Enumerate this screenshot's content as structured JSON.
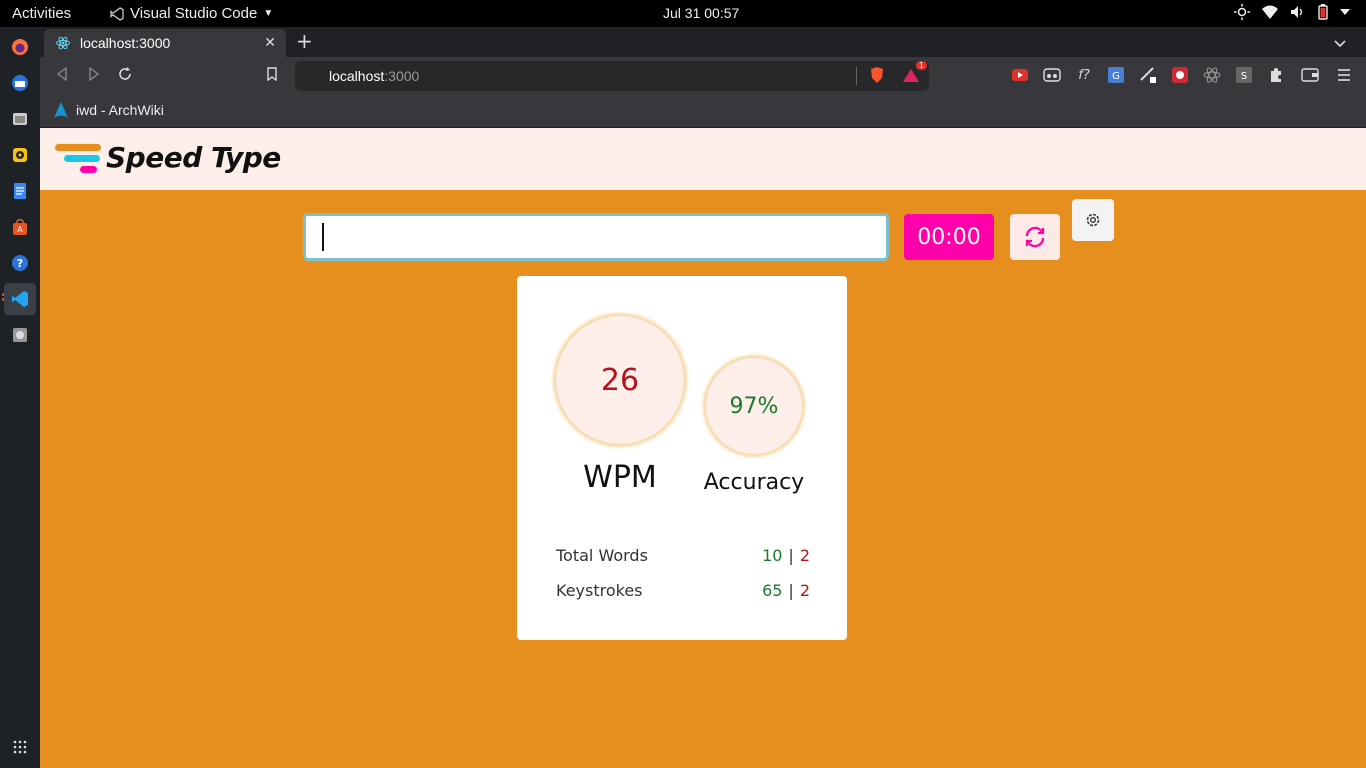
{
  "topbar": {
    "activities": "Activities",
    "app_name": "Visual Studio Code",
    "clock": "Jul 31  00:57"
  },
  "dock": {
    "items": [
      "firefox",
      "thunderbird",
      "files",
      "rhythmbox",
      "writer",
      "software",
      "help",
      "vscode",
      "disks"
    ]
  },
  "browser": {
    "tab_title": "localhost:3000",
    "url_host": "localhost",
    "url_port": ":3000",
    "bookmark": "iwd - ArchWiki",
    "extension_badge": "1"
  },
  "app": {
    "brand": "Speed Type",
    "input_value": "",
    "timer": "00:00",
    "wpm": "26",
    "wpm_label": "WPM",
    "accuracy": "97%",
    "accuracy_label": "Accuracy",
    "stats": [
      {
        "label": "Total Words",
        "correct": "10",
        "separator": "|",
        "incorrect": "2"
      },
      {
        "label": "Keystrokes",
        "correct": "65",
        "separator": "|",
        "incorrect": "2"
      }
    ]
  },
  "colors": {
    "page_bg": "#e68f1f",
    "header_bg": "#fdeeea",
    "timer_bg": "#ff00aa",
    "correct": "#1a7a2e",
    "incorrect": "#b5121b"
  }
}
